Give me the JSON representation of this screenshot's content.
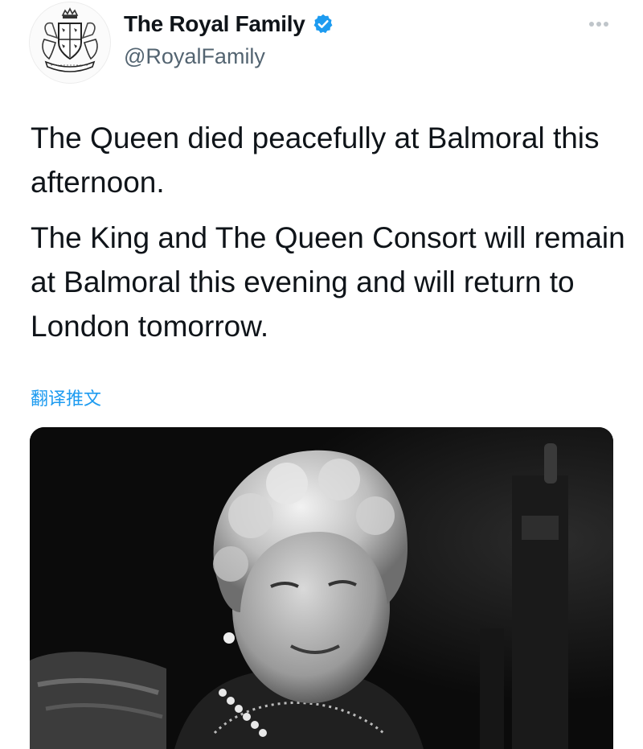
{
  "tweet": {
    "display_name": "The Royal Family",
    "handle": "@RoyalFamily",
    "verified": true,
    "paragraphs": [
      "The Queen died peacefully at Balmoral this afternoon.",
      "The King and The Queen Consort will remain at Balmoral this evening and will return to London tomorrow."
    ],
    "translate_label": "翻译推文",
    "avatar_icon": "royal-coat-of-arms",
    "more_icon": "more-options-icon",
    "media_description_icon": "photo"
  },
  "colors": {
    "text": "#0f1419",
    "secondary": "#536471",
    "accent": "#1d9bf0"
  }
}
